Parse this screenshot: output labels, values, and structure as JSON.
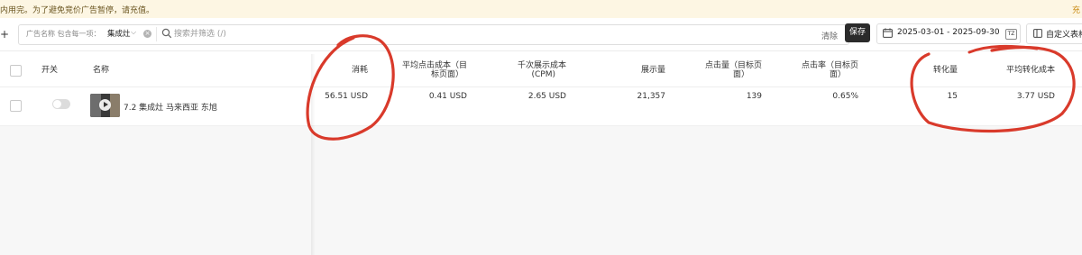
{
  "banner": {
    "message": "内用完。为了避免竞价广告暂停，请充值。",
    "link": "充"
  },
  "toolbar": {
    "add_icon": "+",
    "filter_chip": {
      "label": "广告名称 包含每一项：",
      "value": "集成灶",
      "chevron": "⌵",
      "clear": "×"
    },
    "search_placeholder": "搜索并筛选 (/)",
    "clear_label": "清除",
    "save_label": "保存",
    "date_range": "2025-03-01 - 2025-09-30",
    "tz_label": "TZ",
    "customize_label": "自定义表格"
  },
  "table": {
    "headers": {
      "toggle": "开关",
      "name": "名称",
      "spend": "消耗",
      "cpc_line1": "平均点击成本（目",
      "cpc_line2": "标页面）",
      "cpm_line1": "千次展示成本",
      "cpm_line2": "(CPM)",
      "impressions": "展示量",
      "clicks_line1": "点击量（目标页",
      "clicks_line2": "面）",
      "ctr_line1": "点击率（目标页",
      "ctr_line2": "面）",
      "conversions": "转化量",
      "cpa": "平均转化成本"
    },
    "row": {
      "name": "7.2 集成灶 马来西亚 东旭",
      "spend": "56.51 USD",
      "cpc": "0.41 USD",
      "cpm": "2.65 USD",
      "impressions": "21,357",
      "clicks": "139",
      "ctr": "0.65%",
      "conversions": "15",
      "cpa": "3.77 USD",
      "status_on": false
    }
  },
  "annotation_color": "#d93a2b"
}
